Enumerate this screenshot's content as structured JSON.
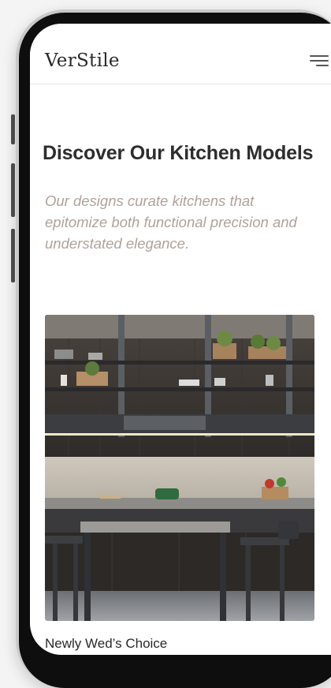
{
  "header": {
    "brand": "VerStile",
    "menu_icon": "hamburger-menu-icon"
  },
  "hero": {
    "title": "Discover Our Kitchen Models",
    "subtitle": "Our designs curate kitchens that epitomize both functional precision and understated elegance."
  },
  "model": {
    "caption": "Newly Wed’s Choice"
  },
  "colors": {
    "accent_text": "#b0a29a",
    "frame": "#0e0e0e"
  }
}
